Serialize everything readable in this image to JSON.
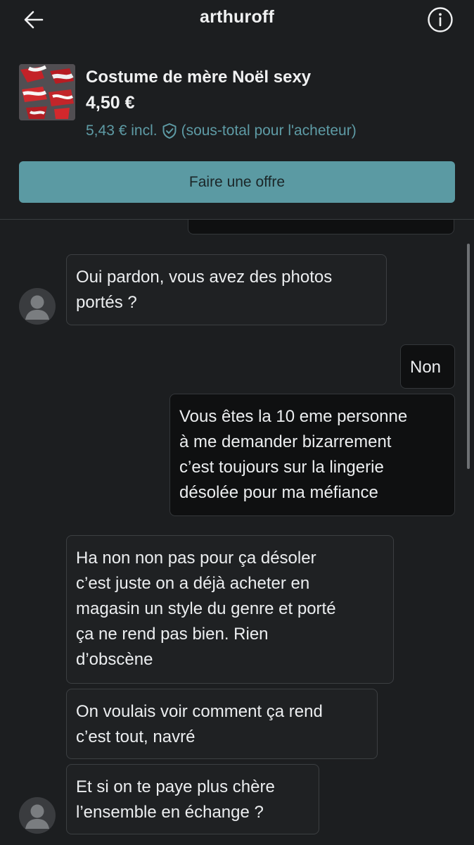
{
  "header": {
    "title": "arthuroff",
    "back_icon": "arrow-left-icon",
    "info_icon": "info-circle-icon"
  },
  "item": {
    "title": "Costume de mère Noël sexy",
    "price": "4,50 €",
    "incl_price": "5,43 € incl.",
    "incl_note": "(sous-total pour l'acheteur)",
    "protection_icon": "shield-check-icon",
    "offer_label": "Faire une offre"
  },
  "messages": [
    {
      "from": "other",
      "text": "Oui pardon, vous avez des photos\nportés ?"
    },
    {
      "from": "me",
      "text": "Non"
    },
    {
      "from": "me",
      "text": "Vous êtes la 10 eme personne\nà me demander bizarrement\nc’est toujours sur la lingerie\ndésolée pour ma méfiance"
    },
    {
      "from": "other",
      "text": "Ha non non pas pour ça désoler\nc’est juste on a déjà acheter en\nmagasin un style du genre et porté\nça ne rend pas bien. Rien\nd’obscène"
    },
    {
      "from": "other",
      "text": "On voulais voir comment ça rend\nc’est tout, navré"
    },
    {
      "from": "other",
      "text": "Et si on te paye plus chère\nl’ensemble en échange ?"
    }
  ],
  "colors": {
    "background": "#1c1e20",
    "accent": "#5b9aa3",
    "incoming_bubble": "#1f2123",
    "outgoing_bubble": "#0f1011"
  }
}
